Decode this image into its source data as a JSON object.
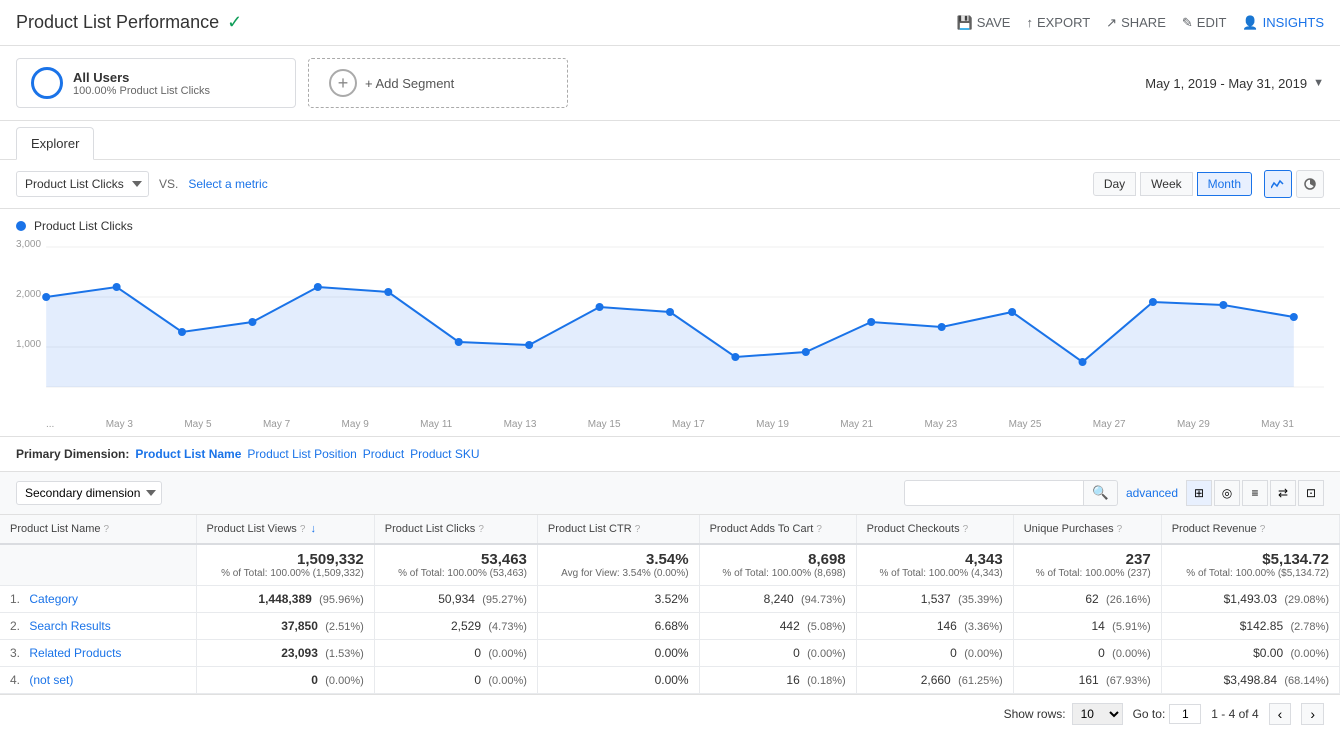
{
  "header": {
    "title": "Product List Performance",
    "verified": true,
    "actions": [
      {
        "label": "SAVE",
        "icon": "save-icon"
      },
      {
        "label": "EXPORT",
        "icon": "export-icon"
      },
      {
        "label": "SHARE",
        "icon": "share-icon"
      },
      {
        "label": "EDIT",
        "icon": "edit-icon"
      },
      {
        "label": "INSIGHTS",
        "icon": "insights-icon"
      }
    ]
  },
  "segments": {
    "active": {
      "name": "All Users",
      "sub": "100.00% Product List Clicks"
    },
    "add_label": "+ Add Segment"
  },
  "date_range": "May 1, 2019 - May 31, 2019",
  "tabs": [
    "Explorer"
  ],
  "active_tab": "Explorer",
  "metric_controls": {
    "selected_metric": "Product List Clicks",
    "vs_label": "VS.",
    "select_metric_label": "Select a metric",
    "time_buttons": [
      "Day",
      "Week",
      "Month"
    ],
    "active_time": "Month"
  },
  "chart": {
    "legend_label": "Product List Clicks",
    "y_labels": [
      "3,000",
      "2,000",
      "1,000"
    ],
    "x_labels": [
      "...",
      "May 3",
      "May 5",
      "May 7",
      "May 9",
      "May 11",
      "May 13",
      "May 15",
      "May 17",
      "May 19",
      "May 21",
      "May 23",
      "May 25",
      "May 27",
      "May 29",
      "May 31"
    ]
  },
  "primary_dimension": {
    "label": "Primary Dimension:",
    "active": "Product List Name",
    "options": [
      "Product List Position",
      "Product",
      "Product SKU"
    ]
  },
  "table_controls": {
    "secondary_dim_label": "Secondary dimension",
    "search_placeholder": "",
    "advanced_label": "advanced"
  },
  "table": {
    "columns": [
      {
        "label": "Product List Name",
        "help": true
      },
      {
        "label": "Product List Views",
        "help": true,
        "sort": true
      },
      {
        "label": "Product List Clicks",
        "help": true
      },
      {
        "label": "Product List CTR",
        "help": true
      },
      {
        "label": "Product Adds To Cart",
        "help": true
      },
      {
        "label": "Product Checkouts",
        "help": true
      },
      {
        "label": "Unique Purchases",
        "help": true
      },
      {
        "label": "Product Revenue",
        "help": true
      }
    ],
    "totals": {
      "views_main": "1,509,332",
      "views_sub": "% of Total: 100.00% (1,509,332)",
      "clicks_main": "53,463",
      "clicks_sub": "% of Total: 100.00% (53,463)",
      "ctr_main": "3.54%",
      "ctr_sub": "Avg for View: 3.54% (0.00%)",
      "adds_main": "8,698",
      "adds_sub": "% of Total: 100.00% (8,698)",
      "checkouts_main": "4,343",
      "checkouts_sub": "% of Total: 100.00% (4,343)",
      "purchases_main": "237",
      "purchases_sub": "% of Total: 100.00% (237)",
      "revenue_main": "$5,134.72",
      "revenue_sub": "% of Total: 100.00% ($5,134.72)"
    },
    "rows": [
      {
        "num": "1.",
        "name": "Category",
        "views": "1,448,389",
        "views_pct": "(95.96%)",
        "clicks": "50,934",
        "clicks_pct": "(95.27%)",
        "ctr": "3.52%",
        "adds": "8,240",
        "adds_pct": "(94.73%)",
        "checkouts": "1,537",
        "checkouts_pct": "(35.39%)",
        "purchases": "62",
        "purchases_pct": "(26.16%)",
        "revenue": "$1,493.03",
        "revenue_pct": "(29.08%)"
      },
      {
        "num": "2.",
        "name": "Search Results",
        "views": "37,850",
        "views_pct": "(2.51%)",
        "clicks": "2,529",
        "clicks_pct": "(4.73%)",
        "ctr": "6.68%",
        "adds": "442",
        "adds_pct": "(5.08%)",
        "checkouts": "146",
        "checkouts_pct": "(3.36%)",
        "purchases": "14",
        "purchases_pct": "(5.91%)",
        "revenue": "$142.85",
        "revenue_pct": "(2.78%)"
      },
      {
        "num": "3.",
        "name": "Related Products",
        "views": "23,093",
        "views_pct": "(1.53%)",
        "clicks": "0",
        "clicks_pct": "(0.00%)",
        "ctr": "0.00%",
        "adds": "0",
        "adds_pct": "(0.00%)",
        "checkouts": "0",
        "checkouts_pct": "(0.00%)",
        "purchases": "0",
        "purchases_pct": "(0.00%)",
        "revenue": "$0.00",
        "revenue_pct": "(0.00%)"
      },
      {
        "num": "4.",
        "name": "(not set)",
        "views": "0",
        "views_pct": "(0.00%)",
        "clicks": "0",
        "clicks_pct": "(0.00%)",
        "ctr": "0.00%",
        "adds": "16",
        "adds_pct": "(0.18%)",
        "checkouts": "2,660",
        "checkouts_pct": "(61.25%)",
        "purchases": "161",
        "purchases_pct": "(67.93%)",
        "revenue": "$3,498.84",
        "revenue_pct": "(68.14%)"
      }
    ]
  },
  "pagination": {
    "show_rows_label": "Show rows:",
    "rows_value": "10",
    "goto_label": "Go to:",
    "goto_value": "1",
    "page_info": "1 - 4 of 4"
  }
}
